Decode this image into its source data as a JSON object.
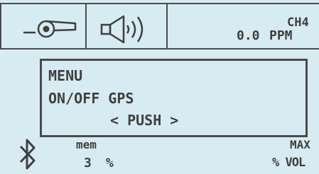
{
  "status_bar": {
    "fan_icon": "fan-icon",
    "speaker_icon": "speaker-icon",
    "gas_name": "CH4",
    "gas_value": "0.0",
    "gas_unit": "PPM"
  },
  "menu_box": {
    "title": "MENU",
    "item": "ON/OFF GPS",
    "action": "< PUSH >"
  },
  "footer": {
    "bluetooth_icon": "bluetooth-icon",
    "mem_label": "mem",
    "mem_value": "3",
    "mem_unit": "%",
    "max_label": "MAX",
    "max_unit": "% VOL"
  },
  "colors": {
    "background": "#d7ecf2",
    "foreground": "#3f3f40"
  }
}
